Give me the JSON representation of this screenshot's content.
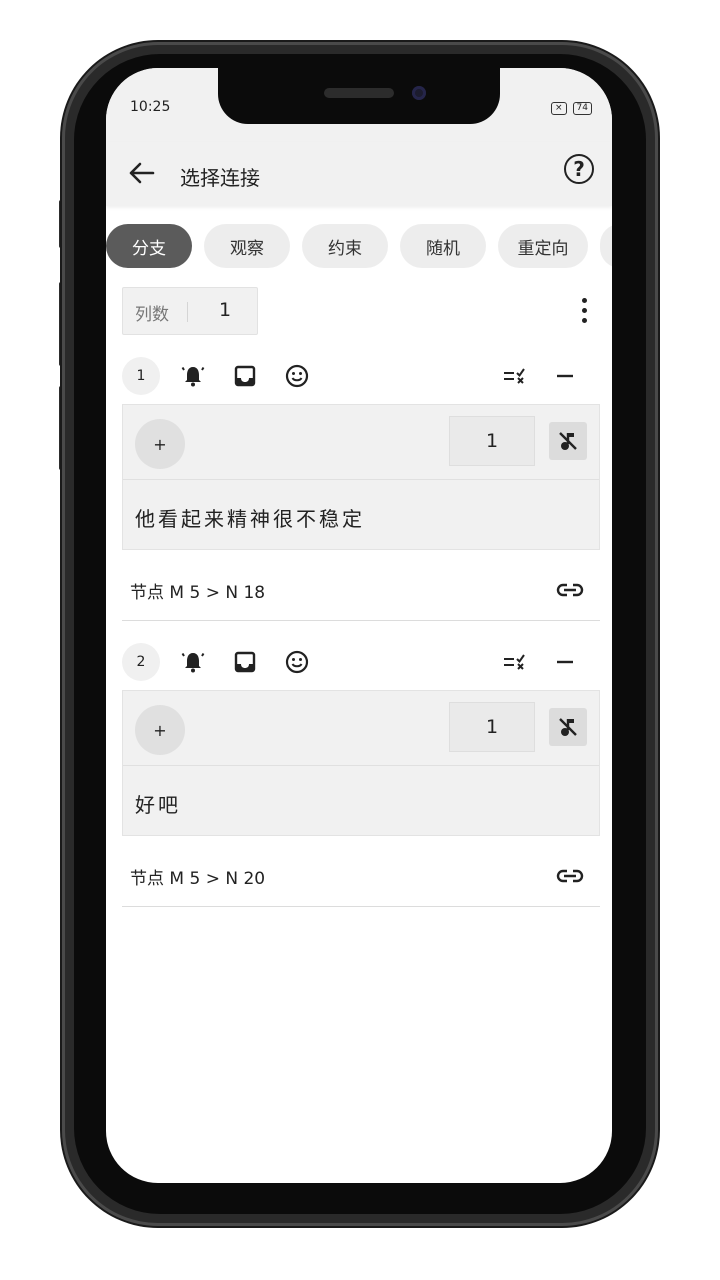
{
  "status_bar": {
    "time": "10:25",
    "battery": "74"
  },
  "app_bar": {
    "title": "选择连接",
    "help_glyph": "?"
  },
  "tabs": [
    {
      "label": "分支",
      "active": true
    },
    {
      "label": "观察",
      "active": false
    },
    {
      "label": "约束",
      "active": false
    },
    {
      "label": "随机",
      "active": false
    },
    {
      "label": "重定向",
      "active": false
    }
  ],
  "columns": {
    "label": "列数",
    "value": "1"
  },
  "branches": [
    {
      "index": "1",
      "plus": "+",
      "weight": "1",
      "text": "他看起来精神很不稳定",
      "node": "节点 M 5 > N 18"
    },
    {
      "index": "2",
      "plus": "+",
      "weight": "1",
      "text": "好吧",
      "node": "节点 M 5 > N 20"
    }
  ],
  "icons": {
    "back": "arrow-left-icon",
    "help": "help-circle-icon",
    "more": "more-vertical-icon",
    "alarm": "alarm-bell-icon",
    "inbox": "inbox-icon",
    "emoji": "smiley-icon",
    "checklist": "checklist-icon",
    "remove": "minus-icon",
    "mute": "music-off-icon",
    "link": "link-icon"
  }
}
